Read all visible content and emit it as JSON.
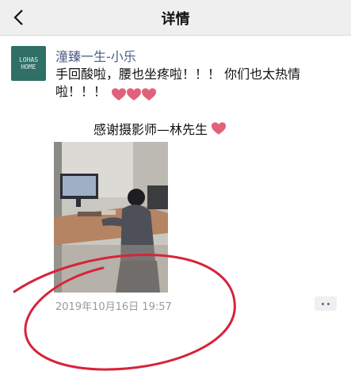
{
  "navbar": {
    "title": "详情"
  },
  "post": {
    "author": "潼臻一生-小乐",
    "avatar_text": "LOHAS HOME",
    "content_text": "手回酸啦，腰也坐疼啦！！！ 你们也太热情啦！！！",
    "thanks_text": "感谢摄影师—林先生",
    "timestamp": "2019年10月16日 19:57"
  },
  "colors": {
    "author_link": "#4a5b86",
    "heart": "#e0627a",
    "annotation_circle": "#d6243a",
    "avatar_bg": "#2f6f66"
  },
  "icons": {
    "back": "chevron-left-icon",
    "more": "more-dots-icon",
    "heart": "heart-icon"
  }
}
